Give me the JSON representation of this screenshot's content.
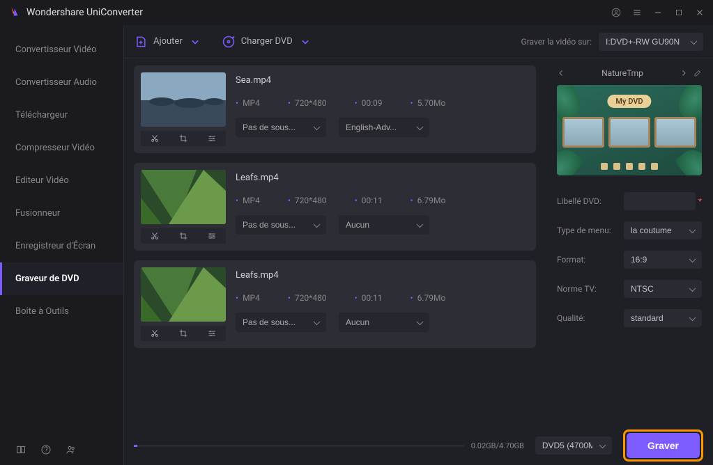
{
  "app": {
    "title": "Wondershare UniConverter"
  },
  "sidebar": {
    "items": [
      {
        "label": "Convertisseur Vidéo"
      },
      {
        "label": "Convertisseur Audio"
      },
      {
        "label": "Téléchargeur"
      },
      {
        "label": "Compresseur Vidéo"
      },
      {
        "label": "Editeur Vidéo"
      },
      {
        "label": "Fusionneur"
      },
      {
        "label": "Enregistreur d'Écran"
      },
      {
        "label": "Graveur de DVD"
      },
      {
        "label": "Boîte à Outils"
      }
    ],
    "active_index": 7
  },
  "toolbar": {
    "add_label": "Ajouter",
    "load_dvd_label": "Charger DVD",
    "burn_target_label": "Graver la vidéo sur:",
    "burn_target_value": "I:DVD+-RW GU90N"
  },
  "files": [
    {
      "name": "Sea.mp4",
      "format": "MP4",
      "resolution": "720*480",
      "duration": "00:09",
      "size": "5.70Mo",
      "subtitle": "Pas de sous...",
      "audio": "English-Adv..."
    },
    {
      "name": "Leafs.mp4",
      "format": "MP4",
      "resolution": "720*480",
      "duration": "00:11",
      "size": "6.79Mo",
      "subtitle": "Pas de sous...",
      "audio": "Aucun"
    },
    {
      "name": "Leafs.mp4",
      "format": "MP4",
      "resolution": "720*480",
      "duration": "00:11",
      "size": "6.79Mo",
      "subtitle": "Pas de sous...",
      "audio": "Aucun"
    }
  ],
  "template": {
    "name": "NatureTmp",
    "banner": "My DVD"
  },
  "settings": {
    "label_dvd": "Libellé DVD:",
    "label_dvd_value": "",
    "menu_type": "Type de menu:",
    "menu_type_value": "la coutume",
    "format": "Format:",
    "format_value": "16:9",
    "tv_norm": "Norme TV:",
    "tv_norm_value": "NTSC",
    "quality": "Qualité:",
    "quality_value": "standard"
  },
  "bottom": {
    "progress_text": "0.02GB/4.70GB",
    "disc_type": "DVD5 (4700M",
    "burn_label": "Graver"
  }
}
